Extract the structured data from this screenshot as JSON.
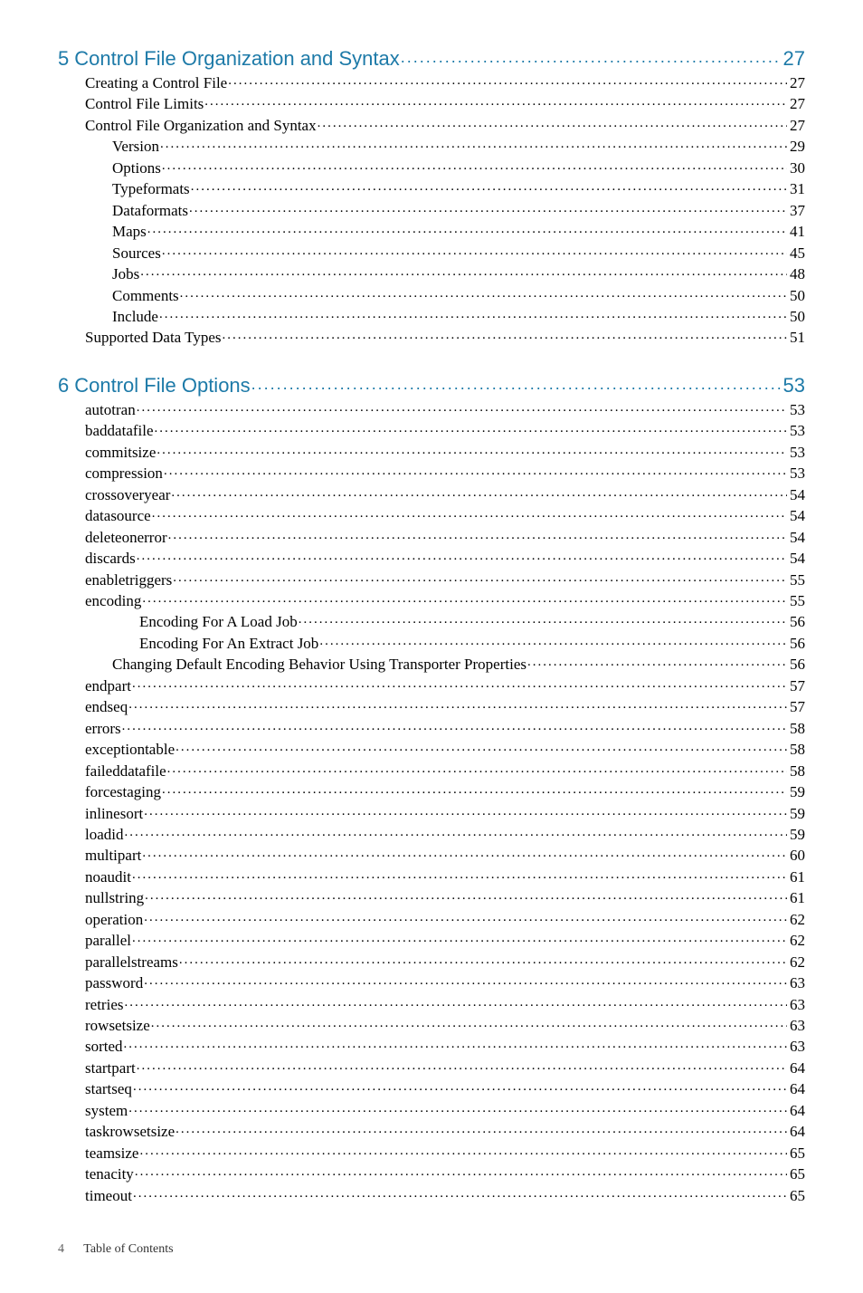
{
  "chapters": [
    {
      "num": "5",
      "title": "Control File Organization and Syntax",
      "page": "27",
      "items": [
        {
          "level": 1,
          "title": "Creating a Control File",
          "page": "27"
        },
        {
          "level": 1,
          "title": "Control File Limits",
          "page": "27"
        },
        {
          "level": 1,
          "title": "Control File Organization and Syntax",
          "page": "27"
        },
        {
          "level": 2,
          "title": "Version",
          "page": "29"
        },
        {
          "level": 2,
          "title": "Options",
          "page": "30"
        },
        {
          "level": 2,
          "title": "Typeformats",
          "page": "31"
        },
        {
          "level": 2,
          "title": "Dataformats",
          "page": "37"
        },
        {
          "level": 2,
          "title": "Maps",
          "page": "41"
        },
        {
          "level": 2,
          "title": "Sources",
          "page": "45"
        },
        {
          "level": 2,
          "title": "Jobs",
          "page": "48"
        },
        {
          "level": 2,
          "title": "Comments",
          "page": "50"
        },
        {
          "level": 2,
          "title": "Include",
          "page": "50"
        },
        {
          "level": 1,
          "title": "Supported Data Types",
          "page": "51"
        }
      ]
    },
    {
      "num": "6",
      "title": "Control File Options",
      "page": "53",
      "items": [
        {
          "level": 1,
          "title": "autotran",
          "page": "53"
        },
        {
          "level": 1,
          "title": "baddatafile",
          "page": "53"
        },
        {
          "level": 1,
          "title": "commitsize",
          "page": "53"
        },
        {
          "level": 1,
          "title": "compression",
          "page": "53"
        },
        {
          "level": 1,
          "title": "crossoveryear",
          "page": "54"
        },
        {
          "level": 1,
          "title": "datasource",
          "page": "54"
        },
        {
          "level": 1,
          "title": "deleteonerror",
          "page": "54"
        },
        {
          "level": 1,
          "title": "discards",
          "page": "54"
        },
        {
          "level": 1,
          "title": "enabletriggers",
          "page": "55"
        },
        {
          "level": 1,
          "title": "encoding",
          "page": "55"
        },
        {
          "level": 3,
          "title": "Encoding For A Load Job",
          "page": "56"
        },
        {
          "level": 3,
          "title": "Encoding For An Extract Job",
          "page": "56"
        },
        {
          "level": 2,
          "title": "Changing Default Encoding Behavior Using Transporter Properties",
          "page": "56"
        },
        {
          "level": 1,
          "title": "endpart",
          "page": "57"
        },
        {
          "level": 1,
          "title": "endseq",
          "page": "57"
        },
        {
          "level": 1,
          "title": "errors",
          "page": "58"
        },
        {
          "level": 1,
          "title": "exceptiontable",
          "page": "58"
        },
        {
          "level": 1,
          "title": "faileddatafile",
          "page": "58"
        },
        {
          "level": 1,
          "title": "forcestaging",
          "page": "59"
        },
        {
          "level": 1,
          "title": "inlinesort",
          "page": "59"
        },
        {
          "level": 1,
          "title": "loadid",
          "page": "59"
        },
        {
          "level": 1,
          "title": "multipart",
          "page": "60"
        },
        {
          "level": 1,
          "title": "noaudit",
          "page": "61"
        },
        {
          "level": 1,
          "title": "nullstring",
          "page": "61"
        },
        {
          "level": 1,
          "title": "operation",
          "page": "62"
        },
        {
          "level": 1,
          "title": "parallel",
          "page": "62"
        },
        {
          "level": 1,
          "title": "parallelstreams",
          "page": "62"
        },
        {
          "level": 1,
          "title": "password",
          "page": "63"
        },
        {
          "level": 1,
          "title": "retries",
          "page": "63"
        },
        {
          "level": 1,
          "title": "rowsetsize",
          "page": "63"
        },
        {
          "level": 1,
          "title": "sorted",
          "page": "63"
        },
        {
          "level": 1,
          "title": "startpart",
          "page": "64"
        },
        {
          "level": 1,
          "title": "startseq",
          "page": "64"
        },
        {
          "level": 1,
          "title": "system",
          "page": "64"
        },
        {
          "level": 1,
          "title": "taskrowsetsize",
          "page": "64"
        },
        {
          "level": 1,
          "title": "teamsize",
          "page": "65"
        },
        {
          "level": 1,
          "title": "tenacity",
          "page": "65"
        },
        {
          "level": 1,
          "title": "timeout",
          "page": "65"
        }
      ]
    }
  ],
  "footer": {
    "pagenum": "4",
    "label": "Table of Contents"
  }
}
